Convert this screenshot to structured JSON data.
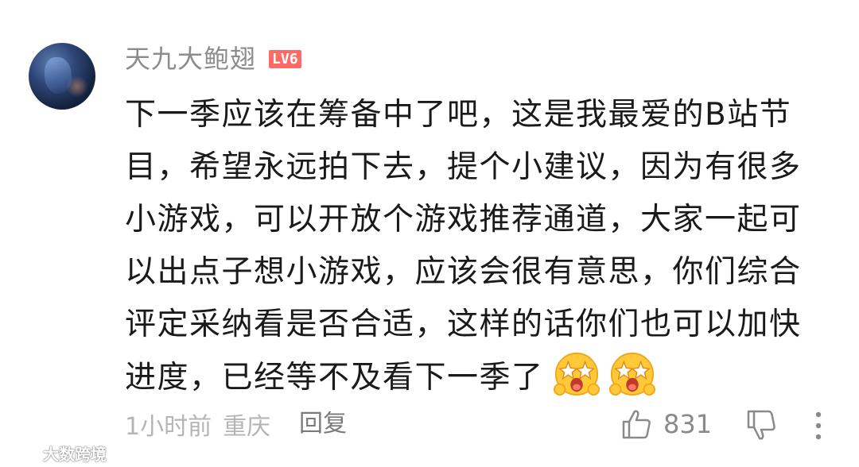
{
  "comment": {
    "username": "天九大鲍翅",
    "level_badge": "LV6",
    "text": "下一季应该在筹备中了吧，这是我最爱的B站节目，希望永远拍下去，提个小建议，因为有很多小游戏，可以开放个游戏推荐通道，大家一起可以出点子想小游戏，应该会很有意思，你们综合评定采纳看是否合适，这样的话你们也可以加快进度，已经等不及看下一季了",
    "emojis": [
      "star-eyes-emoji",
      "star-eyes-emoji"
    ],
    "time": "1小时前",
    "location": "重庆",
    "reply_label": "回复",
    "like_count": "831"
  },
  "watermark": {
    "text": "大数跨境"
  },
  "colors": {
    "badge": "#ff6a66",
    "username": "#8c8c8c",
    "text": "#1a1a1a",
    "meta": "#b5b5b5"
  }
}
